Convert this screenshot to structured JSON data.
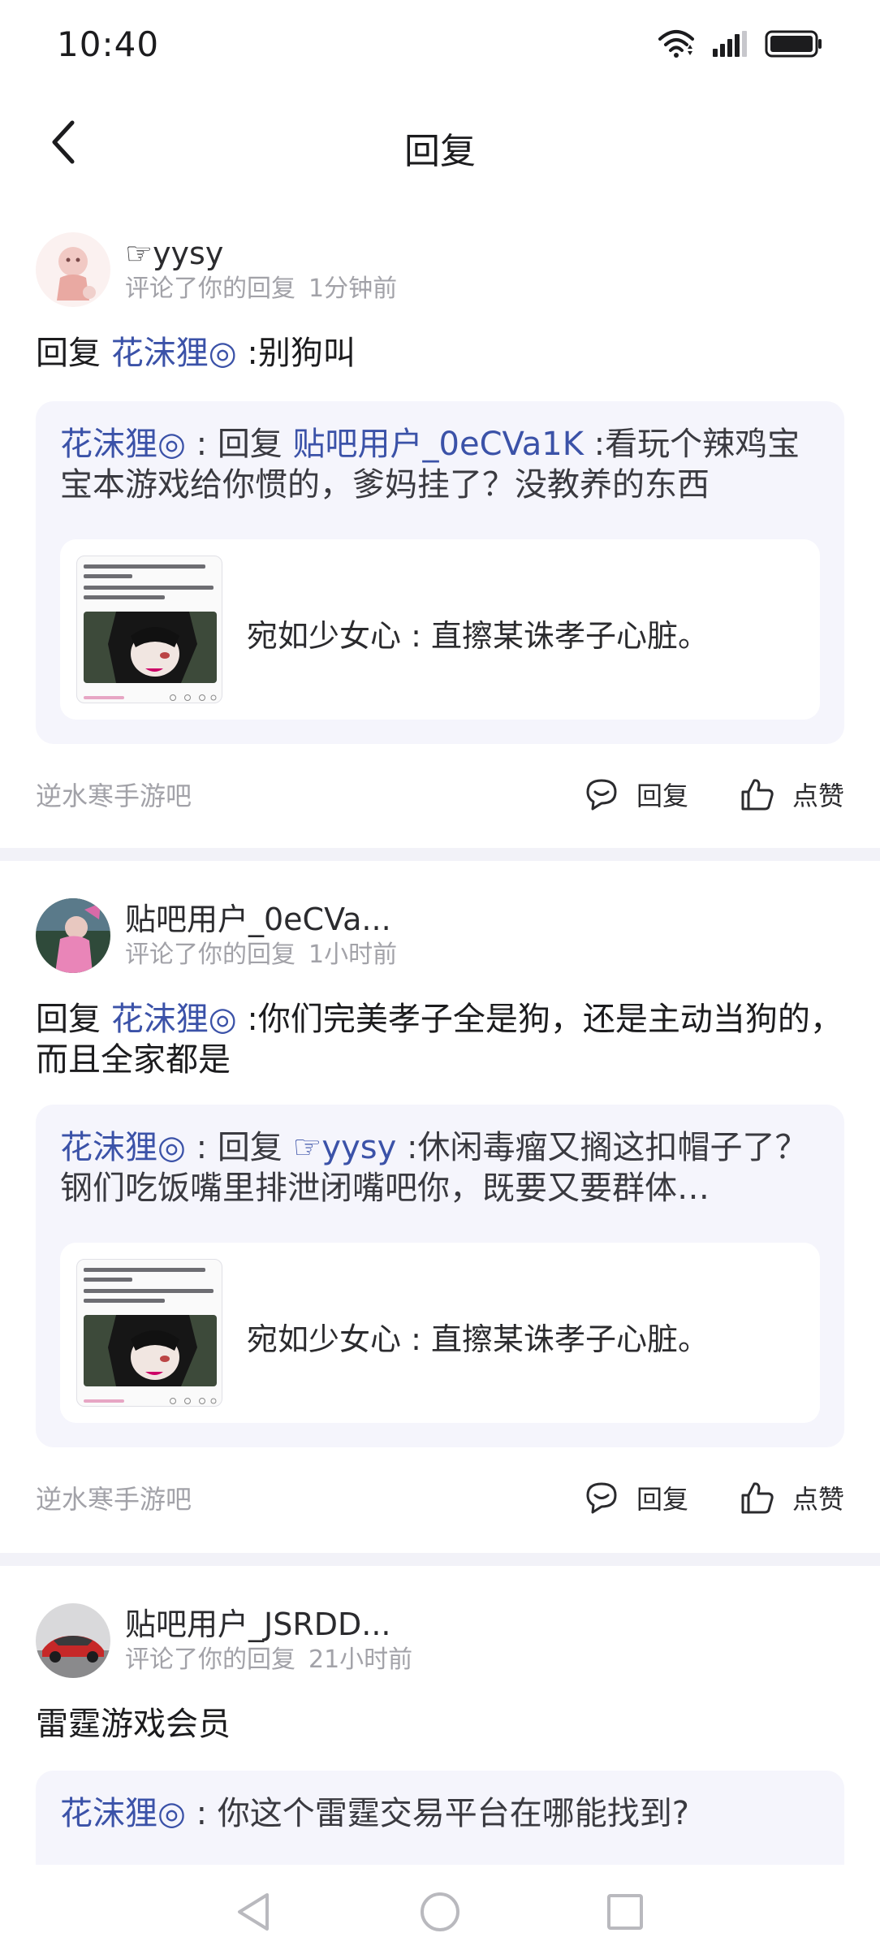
{
  "status_bar": {
    "time": "10:40",
    "icons": [
      "wifi-icon",
      "signal-icon",
      "battery-icon"
    ]
  },
  "header": {
    "title": "回复",
    "back_icon": "chevron-left-icon"
  },
  "colors": {
    "mention": "#3b52a8",
    "quote_bg": "#f5f5fc",
    "muted": "#a2a2a8",
    "divider": "#f2f2f8"
  },
  "replies": [
    {
      "user": "☞yysy",
      "action": "评论了你的回复",
      "time": "1分钟前",
      "reply_prefix": "回复 ",
      "reply_mention": "花沫狸◎",
      "reply_body": " :别狗叫",
      "quote_author": "花沫狸◎",
      "quote_sep": " : 回复 ",
      "quote_mention": "贴吧用户_0eCVa1K",
      "quote_body": " :看玩个辣鸡宝宝本游戏给你惯的，爹妈挂了？没教养的东西",
      "inner_text": "宛如少女心 : 直擦某诛孝子心脏。",
      "forum": "逆水寒手游吧",
      "reply_label": "回复",
      "like_label": "点赞"
    },
    {
      "user": "贴吧用户_0eCVa...",
      "action": "评论了你的回复",
      "time": "1小时前",
      "reply_prefix": "回复 ",
      "reply_mention": "花沫狸◎",
      "reply_body": " :你们完美孝子全是狗，还是主动当狗的，而且全家都是",
      "quote_author": "花沫狸◎",
      "quote_sep": " : 回复 ",
      "quote_mention": "☞yysy",
      "quote_body": " :休闲毒瘤又搁这扣帽子了？钢们吃饭嘴里排泄闭嘴吧你，既要又要群体…",
      "inner_text": "宛如少女心 : 直擦某诛孝子心脏。",
      "forum": "逆水寒手游吧",
      "reply_label": "回复",
      "like_label": "点赞"
    },
    {
      "user": "贴吧用户_JSRDD...",
      "action": "评论了你的回复",
      "time": "21小时前",
      "reply_text": "雷霆游戏会员",
      "quote_author": "花沫狸◎",
      "quote_sep": " : ",
      "quote_body": "你这个雷霆交易平台在哪能找到?"
    }
  ],
  "system_nav": [
    "back-triangle-icon",
    "home-circle-icon",
    "recents-square-icon"
  ]
}
